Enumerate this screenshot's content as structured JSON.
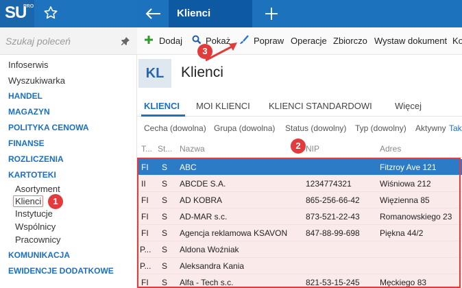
{
  "app": {
    "logo": "SU",
    "logo_sup": "PRO",
    "active_tab": "Klienci"
  },
  "sidebar": {
    "search_placeholder": "Szukaj poleceń",
    "items": [
      {
        "label": "Infoserwis",
        "kind": "item"
      },
      {
        "label": "Wyszukiwarka",
        "kind": "item"
      },
      {
        "label": "HANDEL",
        "kind": "section"
      },
      {
        "label": "MAGAZYN",
        "kind": "section"
      },
      {
        "label": "POLITYKA CENOWA",
        "kind": "section"
      },
      {
        "label": "FINANSE",
        "kind": "section"
      },
      {
        "label": "ROZLICZENIA",
        "kind": "section"
      },
      {
        "label": "KARTOTEKI",
        "kind": "section"
      },
      {
        "label": "Asortyment",
        "kind": "sub"
      },
      {
        "label": "Klienci",
        "kind": "sub-selected"
      },
      {
        "label": "Instytucje",
        "kind": "sub"
      },
      {
        "label": "Wspólnicy",
        "kind": "sub"
      },
      {
        "label": "Pracownicy",
        "kind": "sub"
      },
      {
        "label": "KOMUNIKACJA",
        "kind": "section"
      },
      {
        "label": "EWIDENCJE DODATKOWE",
        "kind": "section"
      }
    ]
  },
  "toolbar": {
    "add": "Dodaj",
    "show": "Pokaż",
    "edit": "Popraw",
    "operations": "Operacje",
    "bulk": "Zbiorczo",
    "issue_doc": "Wystaw dokument",
    "more": "Ko"
  },
  "header": {
    "code": "KL",
    "title": "Klienci"
  },
  "tabs": {
    "t1": "KLIENCI",
    "t2": "MOI KLIENCI",
    "t3": "KLIENCI STANDARDOWI",
    "more": "Więcej"
  },
  "filters": {
    "f1": "Cecha (dowolna)",
    "f2": "Grupa (dowolna)",
    "f3": "Status (dowolny)",
    "f4": "Typ (dowolny)",
    "f5": "Aktywny",
    "f5_val": "Tak"
  },
  "grid": {
    "columns": [
      "T...",
      "St...",
      "Nazwa",
      "NIP",
      "Adres"
    ],
    "rows": [
      {
        "t": "FI",
        "s": "S",
        "name": "ABC",
        "nip": "",
        "addr": "Fitzroy Ave 121"
      },
      {
        "t": "II",
        "s": "S",
        "name": "ABCDE S.A.",
        "nip": "1234774321",
        "addr": "Wiśniowa 212"
      },
      {
        "t": "FI",
        "s": "S",
        "name": "AD KOBRA",
        "nip": "865-256-66-42",
        "addr": "Więzienna  85"
      },
      {
        "t": "FI",
        "s": "S",
        "name": "AD-MAR s.c.",
        "nip": "873-521-22-43",
        "addr": "Romanowskiego 23"
      },
      {
        "t": "FI",
        "s": "S",
        "name": "Agencja reklamowa KSAVON",
        "nip": "847-88-99-698",
        "addr": "Piękna  44/2"
      },
      {
        "t": "P...",
        "s": "S",
        "name": "Aldona Woźniak",
        "nip": "",
        "addr": ""
      },
      {
        "t": "P...",
        "s": "S",
        "name": "Aleksandra Kania",
        "nip": "",
        "addr": ""
      },
      {
        "t": "FI",
        "s": "S",
        "name": "Alfa - Tech s.c.",
        "nip": "821-53-15-245",
        "addr": "Męckiego  83"
      }
    ]
  },
  "annotations": {
    "b1": "1",
    "b2": "2",
    "b3": "3"
  },
  "colors": {
    "brand": "#1e73be",
    "selection": "#2b7bc7",
    "highlight": "#e23b3b"
  }
}
